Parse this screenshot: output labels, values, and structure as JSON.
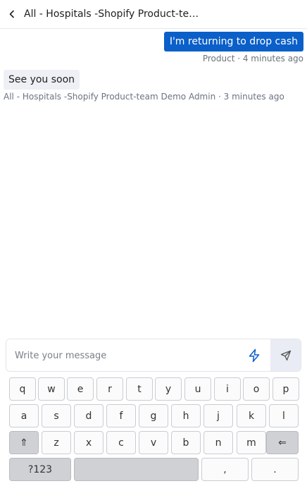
{
  "header": {
    "title": "All - Hospitals -Shopify Product-tea..."
  },
  "messages": [
    {
      "direction": "outgoing",
      "text": "I'm returning to drop cash",
      "meta": "Product · 4 minutes ago"
    },
    {
      "direction": "incoming",
      "text": "See you soon",
      "meta": "All - Hospitals -Shopify Product-team Demo Admin · 3 minutes ago"
    }
  ],
  "composer": {
    "placeholder": "Write your message"
  },
  "keyboard": {
    "row1": [
      "q",
      "w",
      "e",
      "r",
      "t",
      "y",
      "u",
      "i",
      "o",
      "p"
    ],
    "row2": [
      "a",
      "s",
      "d",
      "f",
      "g",
      "h",
      "j",
      "k",
      "l"
    ],
    "shift": "⇑",
    "row3": [
      "z",
      "x",
      "c",
      "v",
      "b",
      "n",
      "m"
    ],
    "backspace": "⇐",
    "symbols": "?123",
    "comma": ",",
    "period": "."
  },
  "colors": {
    "accent": "#0b5fc9",
    "incoming_bubble": "#eef0f6",
    "send_bg": "#e9ecf5"
  }
}
